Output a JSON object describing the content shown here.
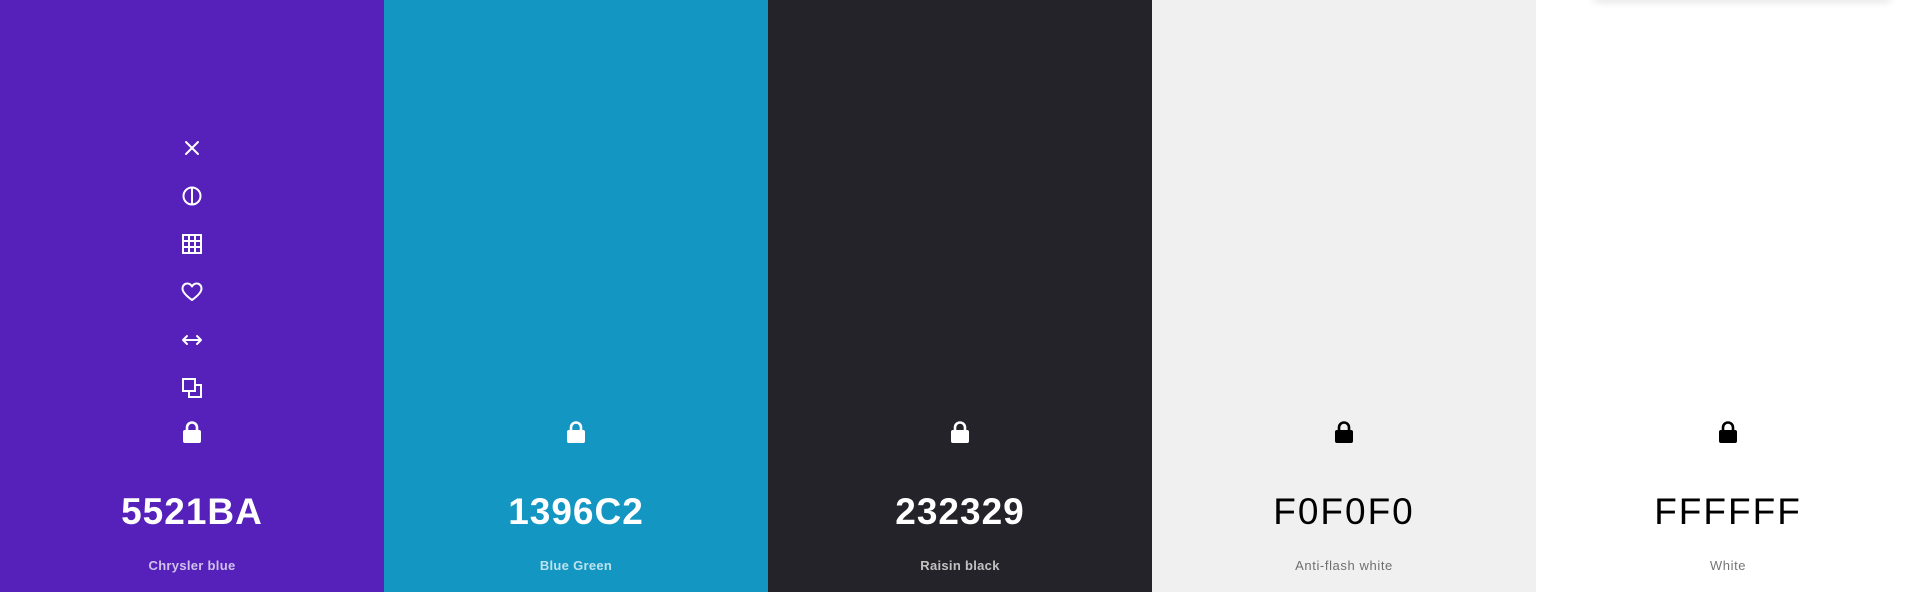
{
  "swatches": [
    {
      "hex": "5521BA",
      "name": "Chrysler blue",
      "color": "#5521BA",
      "tone": "dark",
      "show_toolbar": true
    },
    {
      "hex": "1396C2",
      "name": "Blue Green",
      "color": "#1396C2",
      "tone": "dark",
      "show_toolbar": false
    },
    {
      "hex": "232329",
      "name": "Raisin black",
      "color": "#232329",
      "tone": "dark",
      "show_toolbar": false
    },
    {
      "hex": "F0F0F0",
      "name": "Anti-flash white",
      "color": "#F0F0F0",
      "tone": "light",
      "show_toolbar": false
    },
    {
      "hex": "FFFFFF",
      "name": "White",
      "color": "#FFFFFF",
      "tone": "light",
      "show_toolbar": false
    }
  ],
  "toolbar_icons": [
    "close-icon",
    "contrast-icon",
    "grid-icon",
    "heart-icon",
    "arrows-horizontal-icon",
    "copy-icon"
  ],
  "lock_icon": "lock-icon"
}
